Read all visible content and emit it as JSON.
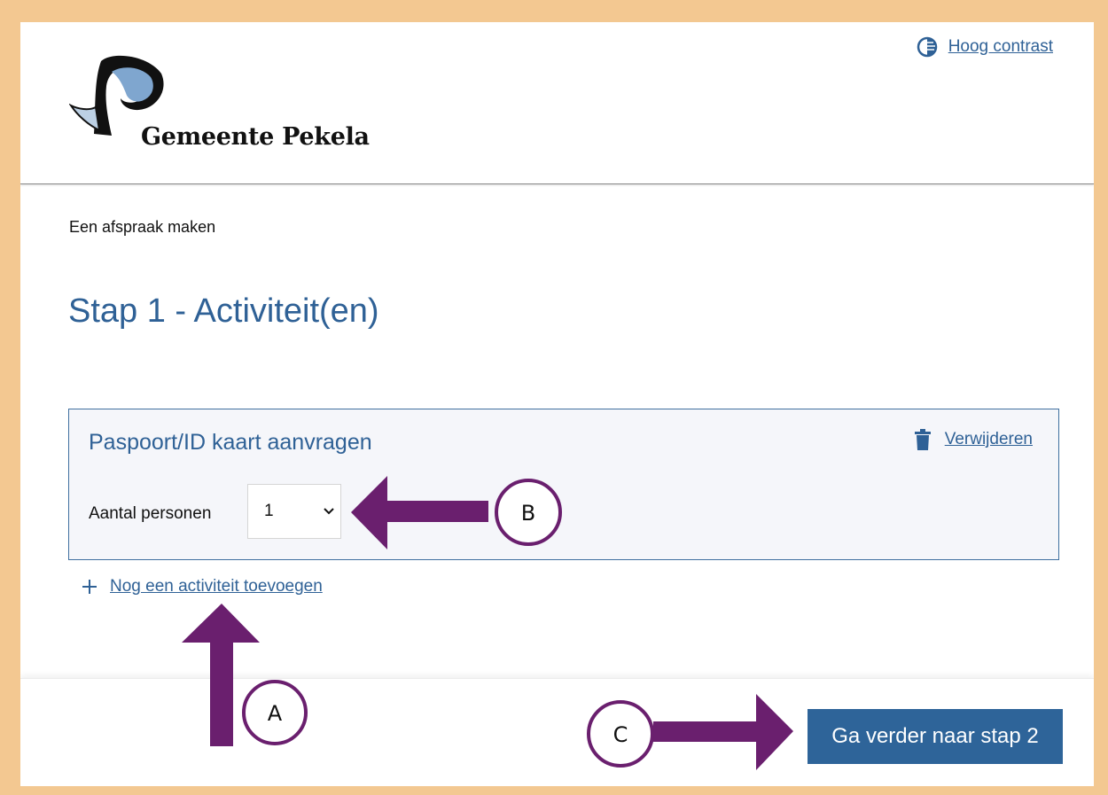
{
  "header": {
    "contrast_label": "Hoog contrast",
    "logo_text": "Gemeente Pekela"
  },
  "breadcrumb": "Een afspraak maken",
  "page_title": "Stap 1 - Activiteit(en)",
  "activity": {
    "title": "Paspoort/ID kaart aanvragen",
    "delete_label": "Verwijderen",
    "quantity_label": "Aantal personen",
    "quantity_value": "1"
  },
  "add_activity_label": "Nog een activiteit toevoegen",
  "footer": {
    "next_button_label": "Ga verder naar stap 2"
  },
  "annotations": {
    "a": "A",
    "b": "B",
    "c": "C",
    "arrow_color": "#6a1f6e"
  },
  "colors": {
    "border_frame": "#f3c891",
    "link": "#2f6196",
    "primary_button": "#2e6499"
  }
}
